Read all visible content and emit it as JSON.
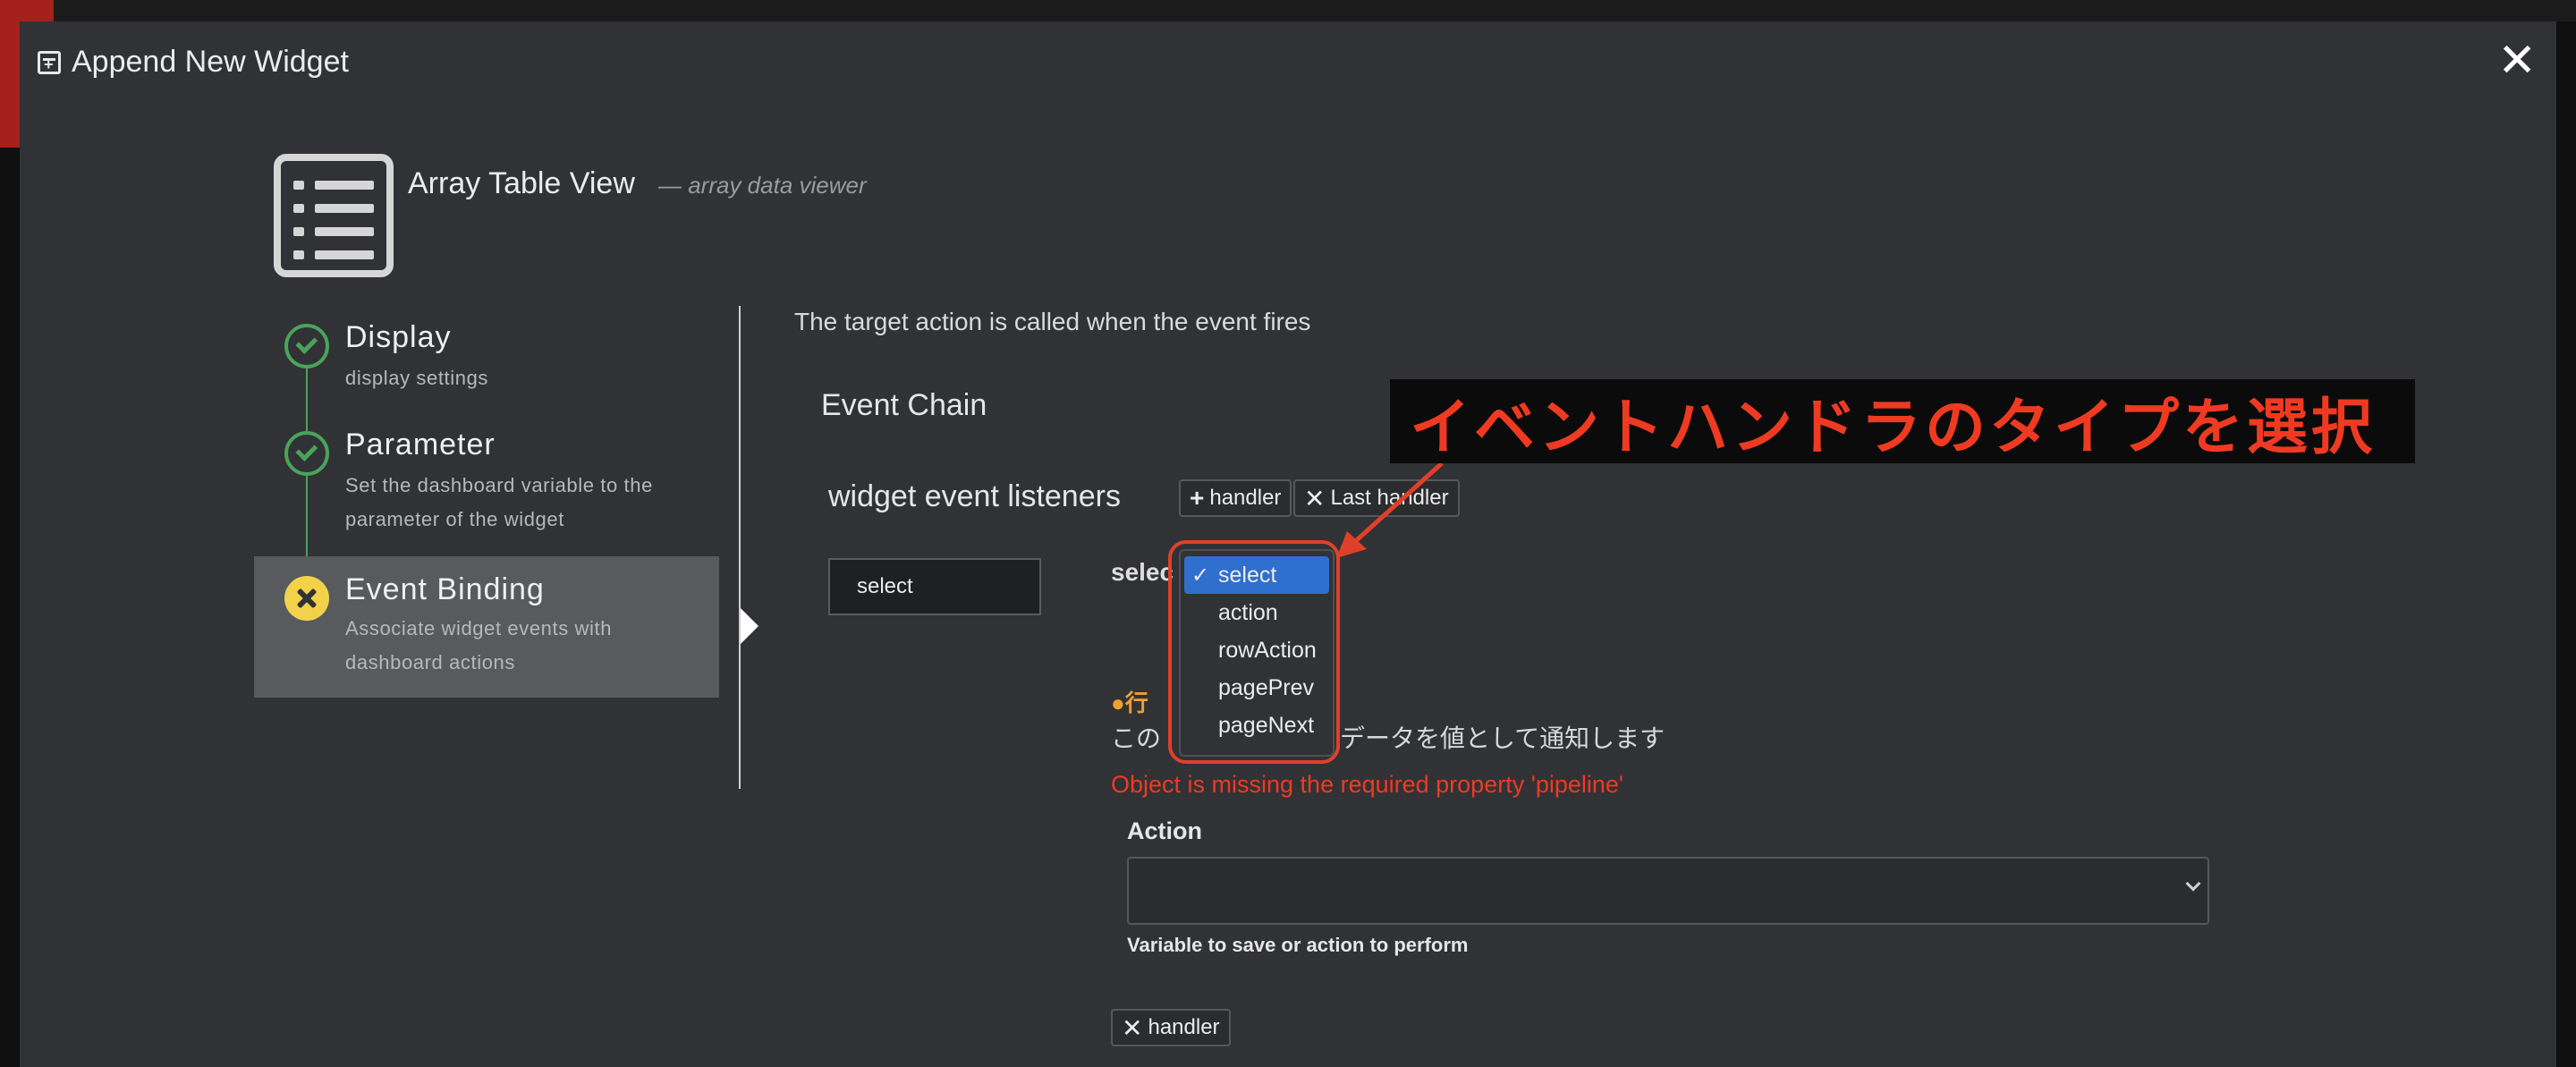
{
  "modal": {
    "title": "Append New Widget",
    "close": "✕"
  },
  "widget": {
    "name": "Array Table View",
    "description": "— array data viewer"
  },
  "steps": [
    {
      "title": "Display",
      "subtitle": "display settings",
      "state": "done"
    },
    {
      "title": "Parameter",
      "subtitle": "Set the dashboard variable to the parameter of the widget",
      "state": "done"
    },
    {
      "title": "Event Binding",
      "subtitle": "Associate widget events with dashboard actions",
      "state": "active"
    }
  ],
  "binding": {
    "target_text": "The target action is called when the event fires",
    "chain_title": "Event Chain",
    "listeners_title": "widget event listeners",
    "add_handler_label": "handler",
    "last_handler_label": "Last handler",
    "listener_item": "select",
    "type_label_visible": "selec",
    "dropdown_options": [
      "select",
      "action",
      "rowAction",
      "pagePrev",
      "pageNext"
    ],
    "dropdown_selected": "select",
    "event_name_visible": "行",
    "event_desc_start": "この",
    "event_desc_end": "データを値として通知します",
    "error": "Object is missing the required property 'pipeline'",
    "action_label": "Action",
    "action_value": "",
    "action_help": "Variable to save or action to perform",
    "remove_handler_label": "handler"
  },
  "annotation": {
    "callout": "イベントハンドラのタイプを選択",
    "color": "#ef3a22"
  },
  "colors": {
    "modal_bg": "#313235",
    "done": "#4aa35a",
    "warn": "#f2d24a",
    "active_step_bg": "#585a5d",
    "selected_option": "#2f6fce"
  }
}
